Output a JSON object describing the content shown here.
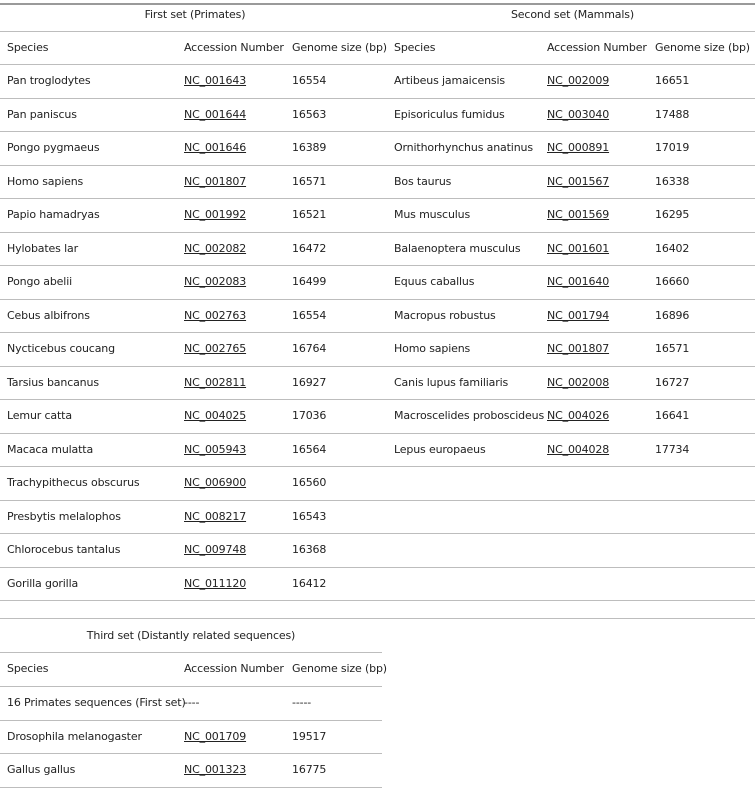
{
  "first_set": {
    "title": "First set (Primates)",
    "headers": [
      "Species",
      "Accession Number",
      "Genome size (bp)"
    ],
    "rows": [
      {
        "species": "Pan troglodytes",
        "accession": "NC_001643",
        "size": "16554"
      },
      {
        "species": "Pan paniscus",
        "accession": "NC_001644",
        "size": "16563"
      },
      {
        "species": "Pongo pygmaeus",
        "accession": "NC_001646",
        "size": "16389"
      },
      {
        "species": "Homo sapiens",
        "accession": "NC_001807",
        "size": "16571"
      },
      {
        "species": "Papio hamadryas",
        "accession": "NC_001992",
        "size": "16521"
      },
      {
        "species": "Hylobates lar",
        "accession": "NC_002082",
        "size": "16472"
      },
      {
        "species": "Pongo abelii",
        "accession": "NC_002083",
        "size": "16499"
      },
      {
        "species": "Cebus albifrons",
        "accession": "NC_002763",
        "size": "16554"
      },
      {
        "species": "Nycticebus coucang",
        "accession": "NC_002765",
        "size": "16764"
      },
      {
        "species": "Tarsius bancanus",
        "accession": "NC_002811",
        "size": "16927"
      },
      {
        "species": "Lemur catta",
        "accession": "NC_004025",
        "size": "17036"
      },
      {
        "species": "Macaca mulatta",
        "accession": "NC_005943",
        "size": "16564"
      },
      {
        "species": "Trachypithecus obscurus",
        "accession": "NC_006900",
        "size": "16560"
      },
      {
        "species": "Presbytis melalophos",
        "accession": "NC_008217",
        "size": "16543"
      },
      {
        "species": "Chlorocebus tantalus",
        "accession": "NC_009748",
        "size": "16368"
      },
      {
        "species": "Gorilla gorilla",
        "accession": "NC_011120",
        "size": "16412"
      }
    ]
  },
  "second_set": {
    "title": "Second set (Mammals)",
    "headers": [
      "Species",
      "Accession Number",
      "Genome size (bp)"
    ],
    "rows": [
      {
        "species": "Artibeus jamaicensis",
        "accession": "NC_002009",
        "size": "16651"
      },
      {
        "species": "Episoriculus fumidus",
        "accession": "NC_003040",
        "size": "17488"
      },
      {
        "species": "Ornithorhynchus anatinus",
        "accession": "NC_000891",
        "size": "17019"
      },
      {
        "species": "Bos taurus",
        "accession": "NC_001567",
        "size": "16338"
      },
      {
        "species": "Mus musculus",
        "accession": "NC_001569",
        "size": "16295"
      },
      {
        "species": "Balaenoptera musculus",
        "accession": "NC_001601",
        "size": "16402"
      },
      {
        "species": "Equus caballus",
        "accession": "NC_001640",
        "size": "16660"
      },
      {
        "species": "Macropus robustus",
        "accession": "NC_001794",
        "size": "16896"
      },
      {
        "species": "Homo sapiens",
        "accession": "NC_001807",
        "size": "16571"
      },
      {
        "species": "Canis lupus familiaris",
        "accession": "NC_002008",
        "size": "16727"
      },
      {
        "species": "Macroscelides proboscideus",
        "accession": "NC_004026",
        "size": "16641"
      },
      {
        "species": "Lepus europaeus",
        "accession": "NC_004028",
        "size": "17734"
      }
    ]
  },
  "third_set": {
    "title": "Third set (Distantly related sequences)",
    "headers": [
      "Species",
      "Accession Number",
      "Genome size (bp)"
    ],
    "rows": [
      {
        "species": "16 Primates sequences (First set)",
        "accession": "----",
        "size": "-----",
        "link": false
      },
      {
        "species": "Drosophila melanogaster",
        "accession": "NC_001709",
        "size": "19517",
        "link": true
      },
      {
        "species": "Gallus gallus",
        "accession": "NC_001323",
        "size": "16775",
        "link": true
      }
    ]
  }
}
